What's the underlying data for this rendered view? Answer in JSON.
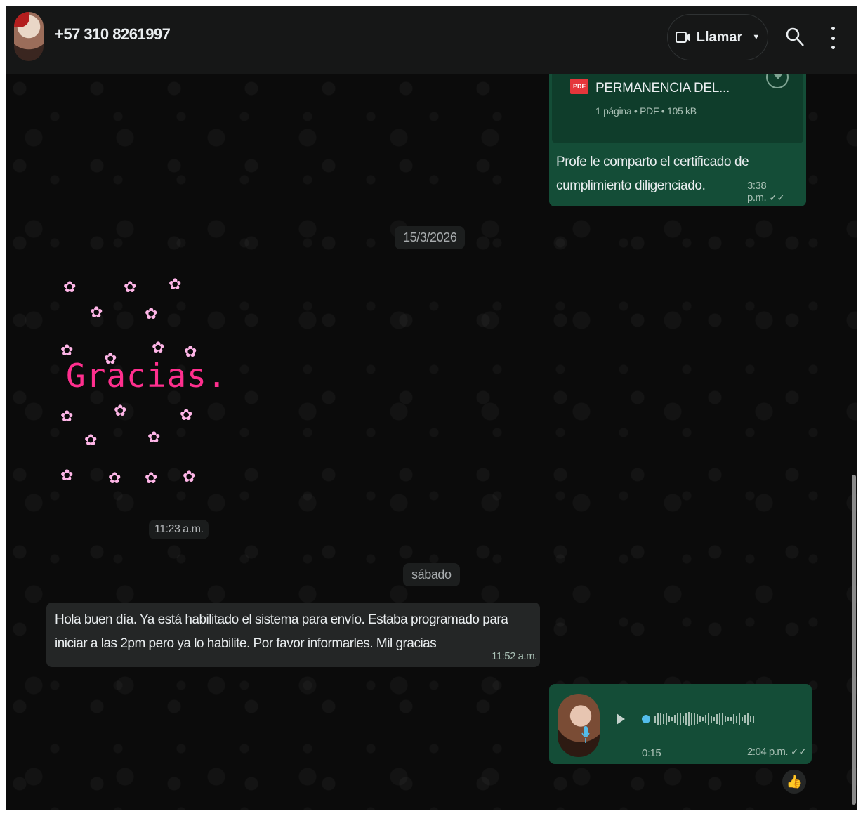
{
  "header": {
    "contact_name": "+57 310 8261997",
    "call_label": "Llamar"
  },
  "messages": {
    "document": {
      "file_type": "PDF",
      "file_name": "PERMANENCIA DEL...",
      "meta": "1 página • PDF • 105 kB",
      "caption": "Profe le comparto el certificado de cumplimiento diligenciado.",
      "time": "3:38 p.m."
    },
    "date_separator_1": "15/3/2026",
    "sticker": {
      "text": "Gracias.",
      "time": "11:23 a.m."
    },
    "date_separator_2": "sábado",
    "incoming": {
      "text": "Hola buen día. Ya está habilitado el sistema para envío. Estaba programado para iniciar a las 2pm pero ya lo habilite. Por favor informarles. Mil gracias",
      "time": "11:52 a.m."
    },
    "voice": {
      "duration": "0:15",
      "time": "2:04 p.m.",
      "reaction": "👍"
    }
  },
  "icons": {
    "call": "video-camera-icon",
    "search": "search-icon",
    "menu": "kebab-menu-icon",
    "pdf": "pdf-icon",
    "download": "download-icon",
    "play": "play-icon",
    "mic": "microphone-icon"
  },
  "colors": {
    "outgoing_bubble": "#144d37",
    "incoming_bubble": "#242626",
    "header_bg": "#161717",
    "accent_blue": "#53bdeb",
    "sticker_text": "#ff2f8e"
  }
}
